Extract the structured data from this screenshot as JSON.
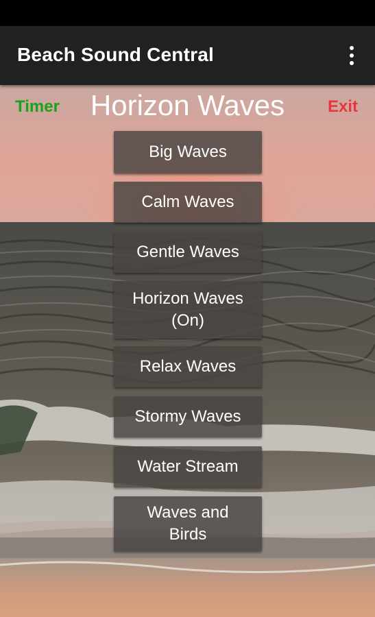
{
  "app_bar": {
    "title": "Beach Sound Central",
    "menu_icon": "more-vert-icon"
  },
  "controls": {
    "timer_label": "Timer",
    "exit_label": "Exit",
    "timer_color": "#19a319",
    "exit_color": "#e8373c"
  },
  "now_playing_title": "Horizon Waves",
  "sounds": [
    {
      "label": "Big Waves"
    },
    {
      "label": "Calm Waves"
    },
    {
      "label": "Gentle Waves"
    },
    {
      "label": "Horizon Waves\n(On)"
    },
    {
      "label": "Relax Waves"
    },
    {
      "label": "Stormy Waves"
    },
    {
      "label": "Water Stream"
    },
    {
      "label": "Waves and\nBirds"
    }
  ],
  "background": {
    "scene": "sunset-beach-waves",
    "sky_color": "#e0a497",
    "sea_color": "#4f4d46",
    "sand_color": "#c99a80"
  }
}
